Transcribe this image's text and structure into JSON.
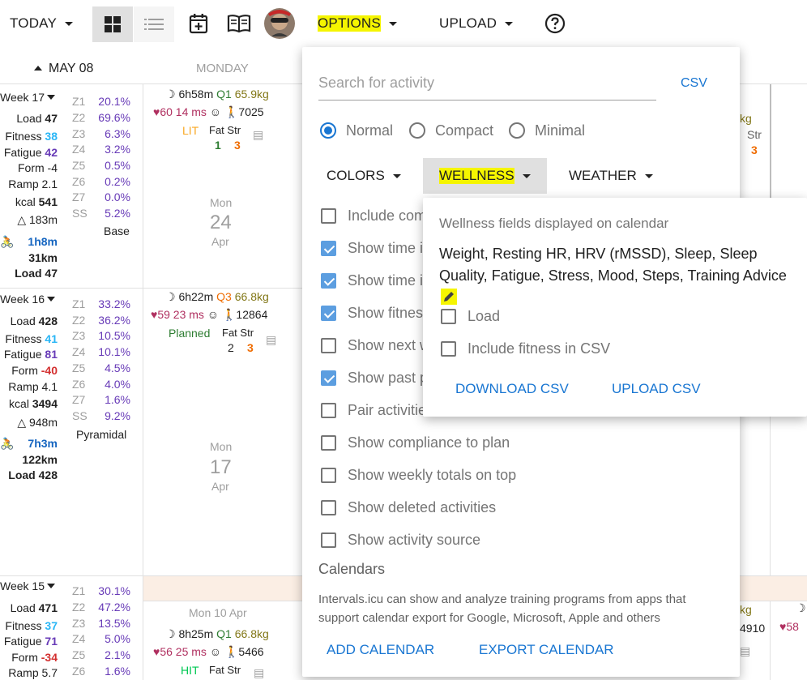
{
  "toolbar": {
    "today": "TODAY",
    "options": "OPTIONS",
    "upload": "UPLOAD",
    "help_icon": "help-circle-icon",
    "add_icon": "calendar-plus-icon",
    "book_icon": "book-icon"
  },
  "calendar": {
    "header_date": "MAY 08",
    "header_day": "MONDAY",
    "weeks": [
      {
        "week": "Week 17",
        "load_label": "Load",
        "load": "47",
        "fitness_label": "Fitness",
        "fitness": "38",
        "fatigue_label": "Fatigue",
        "fatigue": "42",
        "form_label": "Form",
        "form": "-4",
        "ramp_label": "Ramp",
        "ramp": "2.1",
        "kcal_label": "kcal",
        "kcal": "541",
        "climb": "△ 183m",
        "time": "1h8m",
        "dist": "31km",
        "load_total": "Load 47",
        "zones": [
          "Z1",
          "Z2",
          "Z3",
          "Z4",
          "Z5",
          "Z6",
          "Z7",
          "SS"
        ],
        "pcts": [
          "20.1%",
          "69.6%",
          "6.3%",
          "3.2%",
          "0.5%",
          "0.2%",
          "0.0%",
          "5.2%"
        ],
        "kind": "Base",
        "sleep": "6h58m",
        "sq": "Q1",
        "weight": "65.9kg",
        "hr": "60",
        "hrv": "14 ms",
        "steps": "7025",
        "intensity": "LIT",
        "fat_label": "Fat",
        "str_label": "Str",
        "fat": "1",
        "str": "3",
        "day_name": "Mon",
        "day_num": "24",
        "month": "Apr"
      },
      {
        "week": "Week 16",
        "load_label": "Load",
        "load": "428",
        "fitness_label": "Fitness",
        "fitness": "41",
        "fatigue_label": "Fatigue",
        "fatigue": "81",
        "form_label": "Form",
        "form": "-40",
        "ramp_label": "Ramp",
        "ramp": "4.1",
        "kcal_label": "kcal",
        "kcal": "3494",
        "climb": "△ 948m",
        "time": "7h3m",
        "dist": "122km",
        "load_total": "Load 428",
        "zones": [
          "Z1",
          "Z2",
          "Z3",
          "Z4",
          "Z5",
          "Z6",
          "Z7",
          "SS"
        ],
        "pcts": [
          "33.2%",
          "36.2%",
          "10.5%",
          "10.1%",
          "4.5%",
          "4.0%",
          "1.6%",
          "9.2%"
        ],
        "kind": "Pyramidal",
        "sleep": "6h22m",
        "sq": "Q3",
        "weight": "66.8kg",
        "hr": "59",
        "hrv": "23 ms",
        "steps": "12864",
        "intensity": "Planned",
        "fat_label": "Fat",
        "str_label": "Str",
        "fat": "2",
        "str": "3",
        "day_name": "Mon",
        "day_num": "17",
        "month": "Apr"
      },
      {
        "week": "Week 15",
        "load_label": "Load",
        "load": "471",
        "fitness_label": "Fitness",
        "fitness": "37",
        "fatigue_label": "Fatigue",
        "fatigue": "71",
        "form_label": "Form",
        "form": "-34",
        "ramp_label": "Ramp",
        "ramp": "5.7",
        "zones": [
          "Z1",
          "Z2",
          "Z3",
          "Z4",
          "Z5",
          "Z6"
        ],
        "pcts": [
          "30.1%",
          "47.2%",
          "13.5%",
          "5.0%",
          "2.1%",
          "1.6%"
        ],
        "date_label": "Mon 10 Apr",
        "sleep": "8h25m",
        "sq": "Q1",
        "weight": "66.8kg",
        "hr": "56",
        "hrv": "25 ms",
        "steps": "5466",
        "intensity": "HIT",
        "fat_label": "Fat",
        "str_label": "Str"
      }
    ],
    "right_frag": {
      "kg1": "kg",
      "str1": "Str",
      "n1": "3",
      "kg3": "kg",
      "steps3": "4910",
      "hr3": "58"
    }
  },
  "options": {
    "search_placeholder": "Search for activity",
    "csv": "CSV",
    "modes": [
      "Normal",
      "Compact",
      "Minimal"
    ],
    "menus": [
      "COLORS",
      "WELLNESS",
      "WEATHER"
    ],
    "checks": [
      {
        "label": "Include com",
        "on": false
      },
      {
        "label": "Show time i",
        "on": true
      },
      {
        "label": "Show time i",
        "on": true
      },
      {
        "label": "Show fitness",
        "on": true
      },
      {
        "label": "Show next w",
        "on": false
      },
      {
        "label": "Show past p",
        "on": true
      },
      {
        "label": "Pair activitie",
        "on": false
      },
      {
        "label": "Show compliance to plan",
        "on": false
      },
      {
        "label": "Show weekly totals on top",
        "on": false
      },
      {
        "label": "Show deleted activities",
        "on": false
      },
      {
        "label": "Show activity source",
        "on": false
      }
    ],
    "calendars_title": "Calendars",
    "calendars_desc": "Intervals.icu can show and analyze training programs from apps that support calendar export for Google, Microsoft, Apple and others",
    "add_calendar": "ADD CALENDAR",
    "export_calendar": "EXPORT CALENDAR"
  },
  "wellness": {
    "title": "Wellness fields displayed on calendar",
    "fields": "Weight, Resting HR, HRV (rMSSD), Sleep, Sleep Quality, Fatigue, Stress, Mood, Steps, Training Advice",
    "load": "Load",
    "include_fitness": "Include fitness in CSV",
    "download": "DOWNLOAD CSV",
    "upload": "UPLOAD CSV"
  }
}
